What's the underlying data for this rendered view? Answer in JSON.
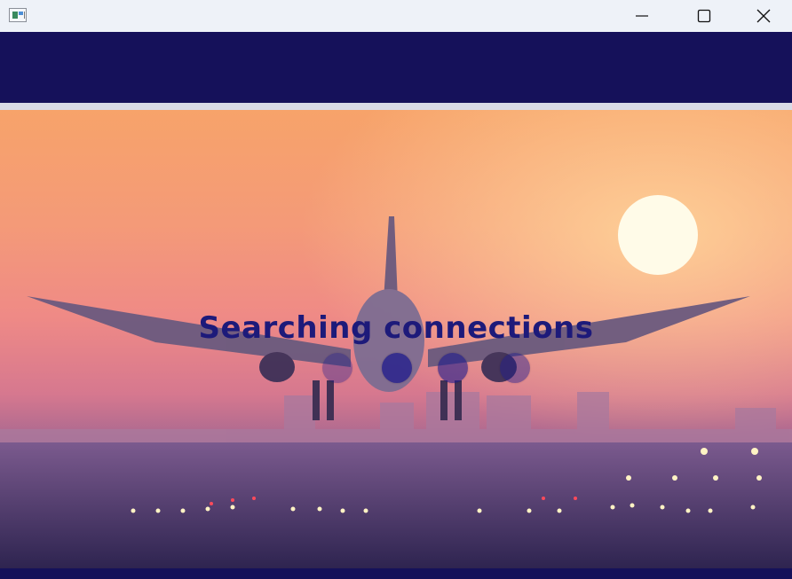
{
  "window": {
    "controls": {
      "minimize_icon": "minimize-icon",
      "maximize_icon": "maximize-icon",
      "close_icon": "close-icon"
    }
  },
  "loading": {
    "message": "Searching connections",
    "dots": [
      {
        "opacity": 0.35
      },
      {
        "opacity": 0.75
      },
      {
        "opacity": 0.6
      },
      {
        "opacity": 0.45
      }
    ]
  },
  "colors": {
    "header": "#15115a",
    "text": "#1d1a7a",
    "dot": "#1e1a8c"
  }
}
